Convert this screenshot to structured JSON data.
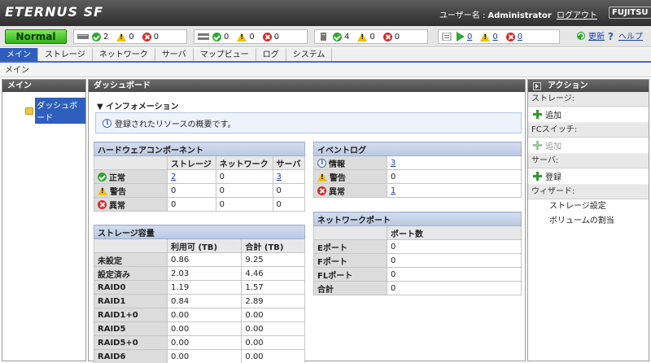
{
  "header": {
    "logo": "ETERNUS SF",
    "user_label": "ユーザー名 : ",
    "user_name": "Administrator",
    "logout": "ログアウト",
    "brand": "FUJITSU"
  },
  "statusbar": {
    "overall": "Normal",
    "groups": [
      {
        "resource": "storage",
        "ok": "2",
        "warn": "0",
        "err": "0"
      },
      {
        "resource": "switch",
        "ok": "0",
        "warn": "0",
        "err": "0"
      },
      {
        "resource": "server",
        "ok": "4",
        "warn": "0",
        "err": "0"
      }
    ],
    "events": {
      "info": "0",
      "warn": "0",
      "err": "0"
    },
    "refresh": "更新",
    "help": "ヘルプ"
  },
  "tabs": [
    "メイン",
    "ストレージ",
    "ネットワーク",
    "サーバ",
    "マップビュー",
    "ログ",
    "システム"
  ],
  "breadcrumb": "メイン",
  "left": {
    "title": "メイン",
    "tree_item": "ダッシュボード"
  },
  "main": {
    "title": "ダッシュボード",
    "info_title": "▼ インフォメーション",
    "info_text": "登録されたリソースの概要です。"
  },
  "hardware": {
    "caption": "ハードウェアコンポーネント",
    "columns": [
      "",
      "ストレージ",
      "ネットワーク",
      "サーバ"
    ],
    "rows": [
      {
        "label": "正常",
        "status": "ok",
        "values": [
          "2",
          "0",
          "3"
        ],
        "links": [
          true,
          false,
          true
        ]
      },
      {
        "label": "警告",
        "status": "warn",
        "values": [
          "0",
          "0",
          "0"
        ],
        "links": [
          false,
          false,
          false
        ]
      },
      {
        "label": "異常",
        "status": "err",
        "values": [
          "0",
          "0",
          "0"
        ],
        "links": [
          false,
          false,
          false
        ]
      }
    ]
  },
  "eventlog": {
    "caption": "イベントログ",
    "rows": [
      {
        "label": "情報",
        "status": "info",
        "value": "3",
        "link": true
      },
      {
        "label": "警告",
        "status": "warn",
        "value": "0",
        "link": false
      },
      {
        "label": "異常",
        "status": "err",
        "value": "1",
        "link": true
      }
    ]
  },
  "capacity": {
    "caption": "ストレージ容量",
    "columns": [
      "",
      "利用可 (TB)",
      "合計 (TB)"
    ],
    "rows": [
      [
        "未設定",
        "0.86",
        "9.25"
      ],
      [
        "設定済み",
        "2.03",
        "4.46"
      ],
      [
        "RAID0",
        "1.19",
        "1.57"
      ],
      [
        "RAID1",
        "0.84",
        "2.89"
      ],
      [
        "RAID1+0",
        "0.00",
        "0.00"
      ],
      [
        "RAID5",
        "0.00",
        "0.00"
      ],
      [
        "RAID5+0",
        "0.00",
        "0.00"
      ],
      [
        "RAID6",
        "0.00",
        "0.00"
      ]
    ]
  },
  "netports": {
    "caption": "ネットワークポート",
    "columns": [
      "",
      "ポート数"
    ],
    "rows": [
      [
        "Eポート",
        "0"
      ],
      [
        "Fポート",
        "0"
      ],
      [
        "FLポート",
        "0"
      ],
      [
        "合計",
        "0"
      ]
    ]
  },
  "actions": {
    "title": "アクション",
    "storage_group": "ストレージ:",
    "storage_add": "追加",
    "fcswitch_group": "FCスイッチ:",
    "fcswitch_add": "追加",
    "server_group": "サーバ:",
    "server_register": "登録",
    "wizard_group": "ウィザード:",
    "wizard_storage": "ストレージ設定",
    "wizard_volume": "ボリュームの割当"
  },
  "colors": {
    "accent": "#2f5fbd",
    "ok": "#2fa82f",
    "warn": "#f0c000",
    "err": "#d62a2a"
  }
}
